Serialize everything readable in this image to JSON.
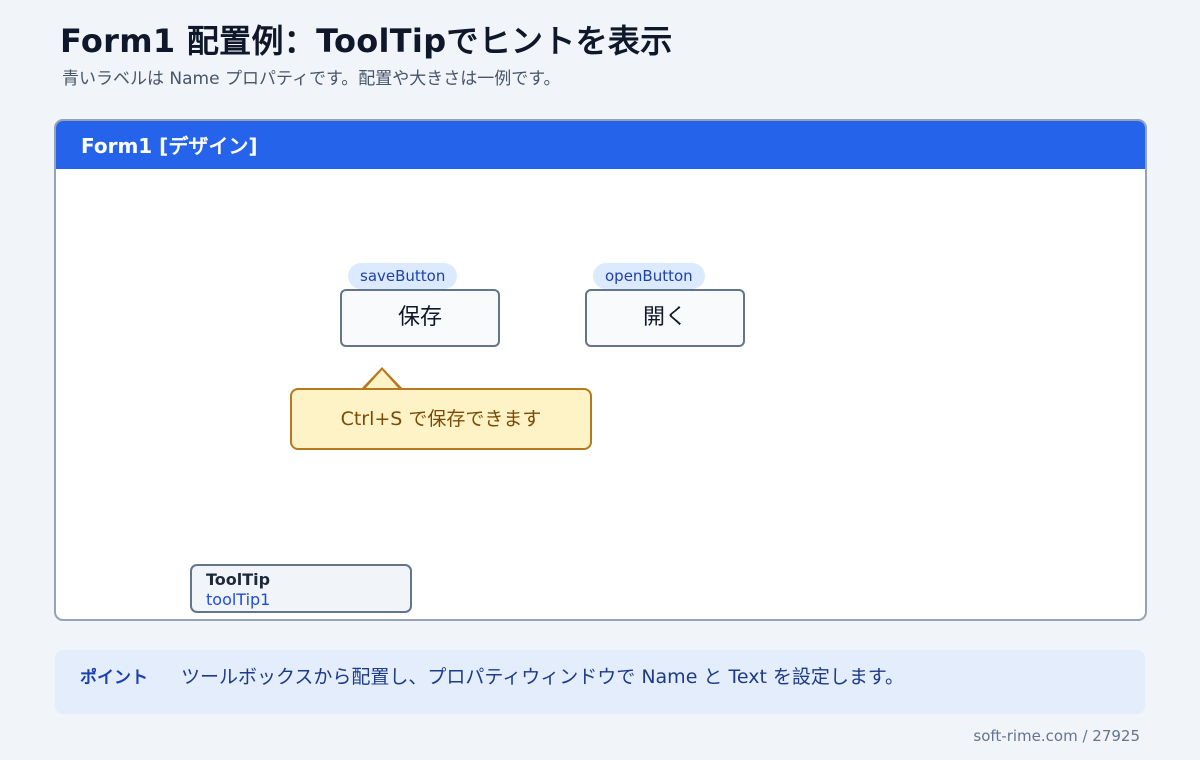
{
  "page": {
    "title": "Form1 配置例：ToolTipでヒントを表示",
    "subtitle": "青いラベルは Name プロパティです。配置や大きさは一例です。"
  },
  "form": {
    "title": "Form1 [デザイン]",
    "save_button": {
      "name_tag": "saveButton",
      "text": "保存"
    },
    "open_button": {
      "name_tag": "openButton",
      "text": "開く"
    },
    "tooltip_text": "Ctrl+S で保存できます",
    "component_tray": {
      "type": "ToolTip",
      "name": "toolTip1"
    }
  },
  "point": {
    "label": "ポイント",
    "text": "ツールボックスから配置し、プロパティウィンドウで Name と Text を設定します。"
  },
  "footer": {
    "credit": "soft-rime.com / 27925"
  },
  "colors": {
    "accent": "#2563eb",
    "name_tag_bg": "#dbeafe",
    "tooltip_bg": "#fef3c7",
    "tooltip_border": "#b7791f"
  }
}
